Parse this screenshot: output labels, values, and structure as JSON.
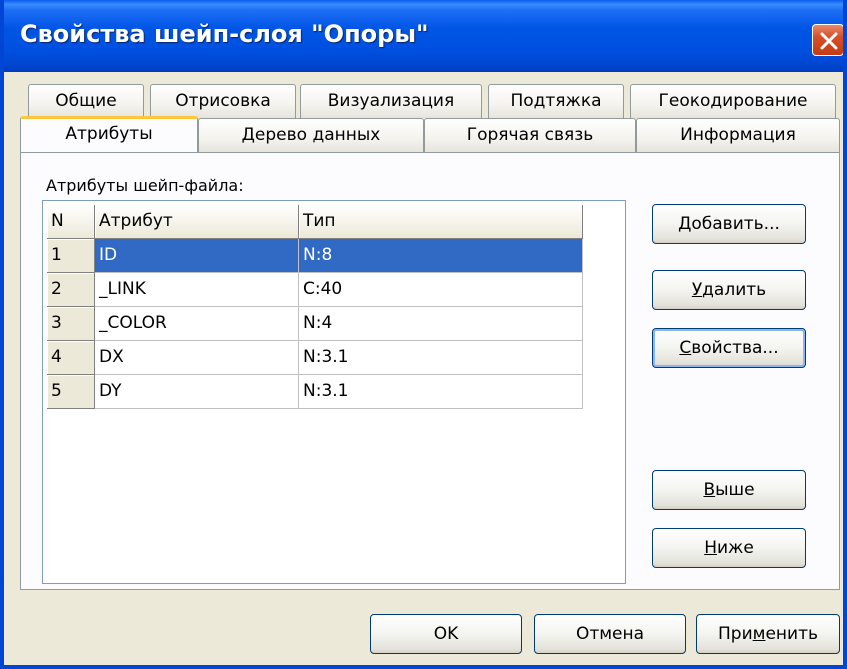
{
  "window": {
    "title": "Свойства шейп-слоя \"Опоры\""
  },
  "tabs_row1": [
    "Общие",
    "Отрисовка",
    "Визуализация",
    "Подтяжка",
    "Геокодирование"
  ],
  "tabs_row2": [
    "Атрибуты",
    "Дерево данных",
    "Горячая связь",
    "Информация"
  ],
  "active_tab": "Атрибуты",
  "attributes": {
    "label": "Атрибуты шейп-файла:",
    "columns": [
      "N",
      "Атрибут",
      "Тип"
    ],
    "rows": [
      {
        "n": "1",
        "name": "ID",
        "type": "N:8"
      },
      {
        "n": "2",
        "name": "_LINK",
        "type": "C:40"
      },
      {
        "n": "3",
        "name": "_COLOR",
        "type": "N:4"
      },
      {
        "n": "4",
        "name": "DX",
        "type": "N:3.1"
      },
      {
        "n": "5",
        "name": "DY",
        "type": "N:3.1"
      }
    ],
    "selected_row": "1"
  },
  "side_buttons": {
    "add": {
      "mnemonic": "Д",
      "rest": "обавить..."
    },
    "delete": {
      "mnemonic": "У",
      "rest": "далить"
    },
    "properties": {
      "mnemonic": "С",
      "rest": "войства..."
    },
    "up": {
      "mnemonic": "В",
      "rest": "ыше"
    },
    "down": {
      "mnemonic": "Н",
      "rest": "иже"
    }
  },
  "footer": {
    "ok": "OK",
    "cancel": "Отмена",
    "apply": {
      "before": "При",
      "mnemonic": "м",
      "after": "енить"
    }
  },
  "colors": {
    "titlebar": "#0055e5",
    "selection": "#316ac5",
    "active_tab_accent": "#ffc83c",
    "close_button": "#c63b14"
  },
  "icons": {
    "close": "close-icon"
  }
}
